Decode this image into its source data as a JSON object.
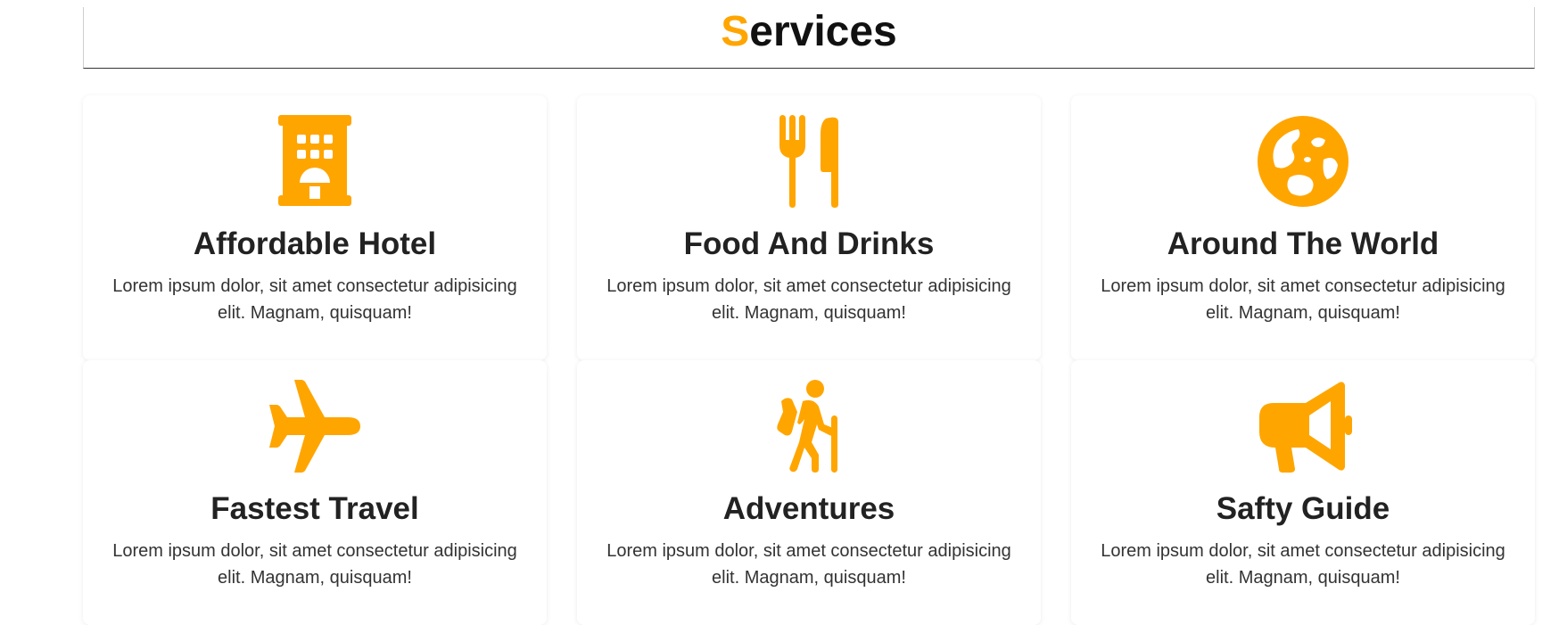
{
  "section": {
    "heading_first_letter": "S",
    "heading_rest": "ervices"
  },
  "colors": {
    "accent": "#ffa500",
    "text": "#222222"
  },
  "cards": [
    {
      "title": "Affordable Hotel",
      "text": "Lorem ipsum dolor, sit amet consectetur adipisicing elit. Magnam, quisquam!",
      "icon": "hotel-icon"
    },
    {
      "title": "Food And Drinks",
      "text": "Lorem ipsum dolor, sit amet consectetur adipisicing elit. Magnam, quisquam!",
      "icon": "utensils-icon"
    },
    {
      "title": "Around The World",
      "text": "Lorem ipsum dolor, sit amet consectetur adipisicing elit. Magnam, quisquam!",
      "icon": "globe-icon"
    },
    {
      "title": "Fastest Travel",
      "text": "Lorem ipsum dolor, sit amet consectetur adipisicing elit. Magnam, quisquam!",
      "icon": "plane-icon"
    },
    {
      "title": "Adventures",
      "text": "Lorem ipsum dolor, sit amet consectetur adipisicing elit. Magnam, quisquam!",
      "icon": "hiking-icon"
    },
    {
      "title": "Safty Guide",
      "text": "Lorem ipsum dolor, sit amet consectetur adipisicing elit. Magnam, quisquam!",
      "icon": "bullhorn-icon"
    }
  ]
}
